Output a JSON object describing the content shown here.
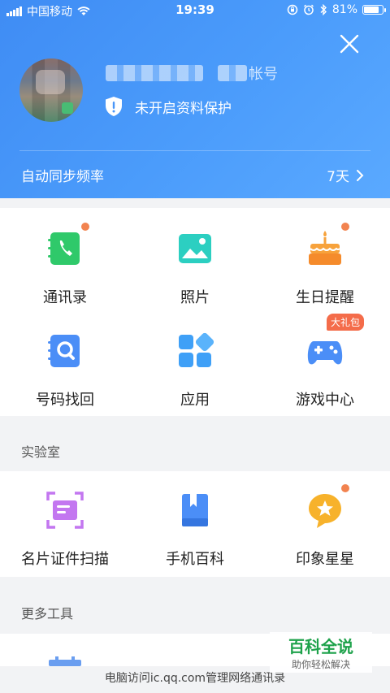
{
  "status_bar": {
    "carrier": "中国移动",
    "time": "19:39",
    "battery": "81%"
  },
  "profile": {
    "account_label": "帐号",
    "protection_status": "未开启资料保护"
  },
  "sync": {
    "label": "自动同步频率",
    "value": "7天"
  },
  "features": [
    {
      "label": "通讯录",
      "icon": "contacts-icon",
      "color": "#2fc96a"
    },
    {
      "label": "照片",
      "icon": "photo-icon",
      "color": "#2ccfc1"
    },
    {
      "label": "生日提醒",
      "icon": "birthday-cake-icon",
      "color": "#f7a23b"
    },
    {
      "label": "号码找回",
      "icon": "number-recovery-icon",
      "color": "#4b8ef7"
    },
    {
      "label": "应用",
      "icon": "apps-icon",
      "color": "#3fa0f7"
    },
    {
      "label": "游戏中心",
      "icon": "gamepad-icon",
      "color": "#4b8ef7",
      "badge": "大礼包"
    }
  ],
  "lab": {
    "title": "实验室",
    "items": [
      {
        "label": "名片证件扫描",
        "icon": "card-scan-icon",
        "color": "#c377f0"
      },
      {
        "label": "手机百科",
        "icon": "encyclopedia-icon",
        "color": "#4b8ef7"
      },
      {
        "label": "印象星星",
        "icon": "star-icon",
        "color": "#f7b22b"
      }
    ]
  },
  "more_tools": {
    "title": "更多工具"
  },
  "footer": {
    "text": "电脑访问ic.qq.com管理网络通讯录"
  },
  "watermark": {
    "title": "百科全说",
    "subtitle": "助你轻松解决"
  }
}
